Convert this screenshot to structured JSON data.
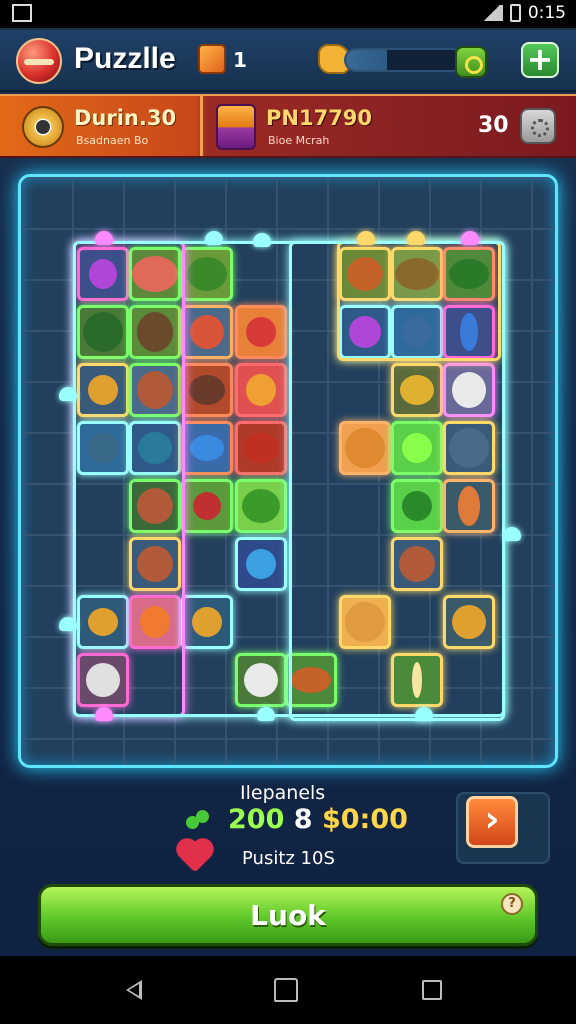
{
  "status_bar": {
    "time": "0:15"
  },
  "header": {
    "title": "Puzzlle",
    "cube_count": "1",
    "progress_fraction": 0.35
  },
  "players": {
    "p1": {
      "name": "Durin.30",
      "sub": "Bsadnaen Bo"
    },
    "p2": {
      "name": "PN17790",
      "sub": "Bioe Mcrah",
      "score": "30"
    }
  },
  "info": {
    "title": "Ilepanels",
    "prize_green": "200",
    "prize_mid": "8",
    "prize_yellow": "$0:00",
    "lives": "Pusitz 10S"
  },
  "main_button": {
    "label": "Luok",
    "help": "?"
  },
  "colors": {
    "accent_glow": "#5fe6ff",
    "primary_button": "#5fc82a",
    "header_orange": "#e26a18"
  },
  "icons": [
    "logo-ball-icon",
    "cube-icon",
    "puzzle-piece-icon",
    "gear-icon",
    "plus-icon",
    "player-avatar-icon",
    "settings-icon",
    "clover-icon",
    "heart-icon",
    "arrow-right-icon",
    "back-icon",
    "home-icon",
    "recent-apps-icon"
  ]
}
